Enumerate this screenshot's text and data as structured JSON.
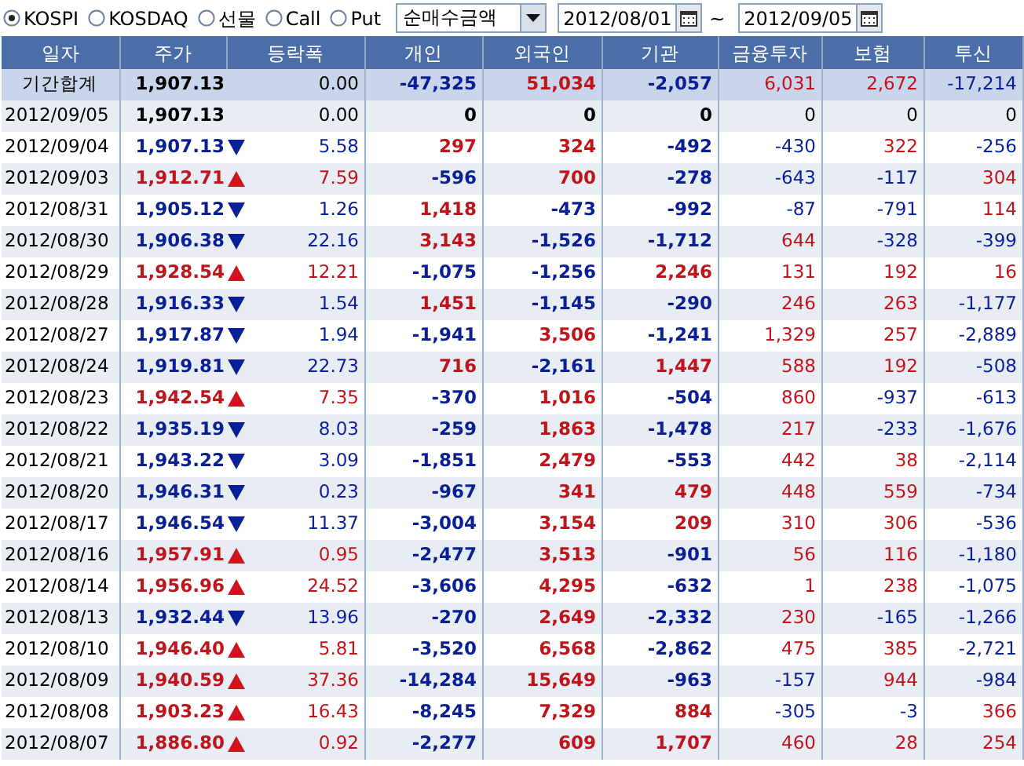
{
  "toolbar": {
    "markets": [
      {
        "label": "KOSPI",
        "selected": true
      },
      {
        "label": "KOSDAQ",
        "selected": false
      },
      {
        "label": "선물",
        "selected": false
      },
      {
        "label": "Call",
        "selected": false
      },
      {
        "label": "Put",
        "selected": false
      }
    ],
    "measure": {
      "value": "순매수금액"
    },
    "start_date": "2012/08/01",
    "separator": "~",
    "end_date": "2012/09/05"
  },
  "table": {
    "columns": [
      "일자",
      "주가",
      "등락폭",
      "개인",
      "외국인",
      "기관",
      "금융투자",
      "보험",
      "투신"
    ],
    "rows": [
      {
        "kind": "total",
        "date": "기간합계",
        "price": {
          "text": "1,907.13",
          "color": "#000000"
        },
        "change": {
          "text": "0.00",
          "color": "#000000"
        },
        "investors": [
          {
            "text": "-47,325",
            "color": "#0a1e96"
          },
          {
            "text": "51,034",
            "color": "#c0141c"
          },
          {
            "text": "-2,057",
            "color": "#0a1e96"
          },
          {
            "text": "6,031",
            "color": "#c0141c"
          },
          {
            "text": "2,672",
            "color": "#c0141c"
          },
          {
            "text": "-17,214",
            "color": "#0a1e96"
          }
        ]
      },
      {
        "kind": "day",
        "date": "2012/09/05",
        "price": {
          "text": "1,907.13",
          "color": "#000000"
        },
        "change": {
          "text": "0.00",
          "color": "#000000"
        },
        "investors": [
          {
            "text": "0",
            "color": "#000000"
          },
          {
            "text": "0",
            "color": "#000000"
          },
          {
            "text": "0",
            "color": "#000000"
          },
          {
            "text": "0",
            "color": "#000000"
          },
          {
            "text": "0",
            "color": "#000000"
          },
          {
            "text": "0",
            "color": "#000000"
          }
        ]
      },
      {
        "kind": "day",
        "date": "2012/09/04",
        "price": {
          "text": "1,907.13",
          "color": "#0a1e96"
        },
        "rising": false,
        "change": {
          "text": "5.58",
          "color": "#0a1e96"
        },
        "investors": [
          {
            "text": "297",
            "color": "#c0141c"
          },
          {
            "text": "324",
            "color": "#c0141c"
          },
          {
            "text": "-492",
            "color": "#0a1e96"
          },
          {
            "text": "-430",
            "color": "#0a1e96"
          },
          {
            "text": "322",
            "color": "#c0141c"
          },
          {
            "text": "-256",
            "color": "#0a1e96"
          }
        ]
      },
      {
        "kind": "day",
        "date": "2012/09/03",
        "price": {
          "text": "1,912.71",
          "color": "#c0141c"
        },
        "rising": true,
        "change": {
          "text": "7.59",
          "color": "#c0141c"
        },
        "investors": [
          {
            "text": "-596",
            "color": "#0a1e96"
          },
          {
            "text": "700",
            "color": "#c0141c"
          },
          {
            "text": "-278",
            "color": "#0a1e96"
          },
          {
            "text": "-643",
            "color": "#0a1e96"
          },
          {
            "text": "-117",
            "color": "#0a1e96"
          },
          {
            "text": "304",
            "color": "#c0141c"
          }
        ]
      },
      {
        "kind": "day",
        "date": "2012/08/31",
        "price": {
          "text": "1,905.12",
          "color": "#0a1e96"
        },
        "rising": false,
        "change": {
          "text": "1.26",
          "color": "#0a1e96"
        },
        "investors": [
          {
            "text": "1,418",
            "color": "#c0141c"
          },
          {
            "text": "-473",
            "color": "#0a1e96"
          },
          {
            "text": "-992",
            "color": "#0a1e96"
          },
          {
            "text": "-87",
            "color": "#0a1e96"
          },
          {
            "text": "-791",
            "color": "#0a1e96"
          },
          {
            "text": "114",
            "color": "#c0141c"
          }
        ]
      },
      {
        "kind": "day",
        "date": "2012/08/30",
        "price": {
          "text": "1,906.38",
          "color": "#0a1e96"
        },
        "rising": false,
        "change": {
          "text": "22.16",
          "color": "#0a1e96"
        },
        "investors": [
          {
            "text": "3,143",
            "color": "#c0141c"
          },
          {
            "text": "-1,526",
            "color": "#0a1e96"
          },
          {
            "text": "-1,712",
            "color": "#0a1e96"
          },
          {
            "text": "644",
            "color": "#c0141c"
          },
          {
            "text": "-328",
            "color": "#0a1e96"
          },
          {
            "text": "-399",
            "color": "#0a1e96"
          }
        ]
      },
      {
        "kind": "day",
        "date": "2012/08/29",
        "price": {
          "text": "1,928.54",
          "color": "#c0141c"
        },
        "rising": true,
        "change": {
          "text": "12.21",
          "color": "#c0141c"
        },
        "investors": [
          {
            "text": "-1,075",
            "color": "#0a1e96"
          },
          {
            "text": "-1,256",
            "color": "#0a1e96"
          },
          {
            "text": "2,246",
            "color": "#c0141c"
          },
          {
            "text": "131",
            "color": "#c0141c"
          },
          {
            "text": "192",
            "color": "#c0141c"
          },
          {
            "text": "16",
            "color": "#c0141c"
          }
        ]
      },
      {
        "kind": "day",
        "date": "2012/08/28",
        "price": {
          "text": "1,916.33",
          "color": "#0a1e96"
        },
        "rising": false,
        "change": {
          "text": "1.54",
          "color": "#0a1e96"
        },
        "investors": [
          {
            "text": "1,451",
            "color": "#c0141c"
          },
          {
            "text": "-1,145",
            "color": "#0a1e96"
          },
          {
            "text": "-290",
            "color": "#0a1e96"
          },
          {
            "text": "246",
            "color": "#c0141c"
          },
          {
            "text": "263",
            "color": "#c0141c"
          },
          {
            "text": "-1,177",
            "color": "#0a1e96"
          }
        ]
      },
      {
        "kind": "day",
        "date": "2012/08/27",
        "price": {
          "text": "1,917.87",
          "color": "#0a1e96"
        },
        "rising": false,
        "change": {
          "text": "1.94",
          "color": "#0a1e96"
        },
        "investors": [
          {
            "text": "-1,941",
            "color": "#0a1e96"
          },
          {
            "text": "3,506",
            "color": "#c0141c"
          },
          {
            "text": "-1,241",
            "color": "#0a1e96"
          },
          {
            "text": "1,329",
            "color": "#c0141c"
          },
          {
            "text": "257",
            "color": "#c0141c"
          },
          {
            "text": "-2,889",
            "color": "#0a1e96"
          }
        ]
      },
      {
        "kind": "day",
        "date": "2012/08/24",
        "price": {
          "text": "1,919.81",
          "color": "#0a1e96"
        },
        "rising": false,
        "change": {
          "text": "22.73",
          "color": "#0a1e96"
        },
        "investors": [
          {
            "text": "716",
            "color": "#c0141c"
          },
          {
            "text": "-2,161",
            "color": "#0a1e96"
          },
          {
            "text": "1,447",
            "color": "#c0141c"
          },
          {
            "text": "588",
            "color": "#c0141c"
          },
          {
            "text": "192",
            "color": "#c0141c"
          },
          {
            "text": "-508",
            "color": "#0a1e96"
          }
        ]
      },
      {
        "kind": "day",
        "date": "2012/08/23",
        "price": {
          "text": "1,942.54",
          "color": "#c0141c"
        },
        "rising": true,
        "change": {
          "text": "7.35",
          "color": "#c0141c"
        },
        "investors": [
          {
            "text": "-370",
            "color": "#0a1e96"
          },
          {
            "text": "1,016",
            "color": "#c0141c"
          },
          {
            "text": "-504",
            "color": "#0a1e96"
          },
          {
            "text": "860",
            "color": "#c0141c"
          },
          {
            "text": "-937",
            "color": "#0a1e96"
          },
          {
            "text": "-613",
            "color": "#0a1e96"
          }
        ]
      },
      {
        "kind": "day",
        "date": "2012/08/22",
        "price": {
          "text": "1,935.19",
          "color": "#0a1e96"
        },
        "rising": false,
        "change": {
          "text": "8.03",
          "color": "#0a1e96"
        },
        "investors": [
          {
            "text": "-259",
            "color": "#0a1e96"
          },
          {
            "text": "1,863",
            "color": "#c0141c"
          },
          {
            "text": "-1,478",
            "color": "#0a1e96"
          },
          {
            "text": "217",
            "color": "#c0141c"
          },
          {
            "text": "-233",
            "color": "#0a1e96"
          },
          {
            "text": "-1,676",
            "color": "#0a1e96"
          }
        ]
      },
      {
        "kind": "day",
        "date": "2012/08/21",
        "price": {
          "text": "1,943.22",
          "color": "#0a1e96"
        },
        "rising": false,
        "change": {
          "text": "3.09",
          "color": "#0a1e96"
        },
        "investors": [
          {
            "text": "-1,851",
            "color": "#0a1e96"
          },
          {
            "text": "2,479",
            "color": "#c0141c"
          },
          {
            "text": "-553",
            "color": "#0a1e96"
          },
          {
            "text": "442",
            "color": "#c0141c"
          },
          {
            "text": "38",
            "color": "#c0141c"
          },
          {
            "text": "-2,114",
            "color": "#0a1e96"
          }
        ]
      },
      {
        "kind": "day",
        "date": "2012/08/20",
        "price": {
          "text": "1,946.31",
          "color": "#0a1e96"
        },
        "rising": false,
        "change": {
          "text": "0.23",
          "color": "#0a1e96"
        },
        "investors": [
          {
            "text": "-967",
            "color": "#0a1e96"
          },
          {
            "text": "341",
            "color": "#c0141c"
          },
          {
            "text": "479",
            "color": "#c0141c"
          },
          {
            "text": "448",
            "color": "#c0141c"
          },
          {
            "text": "559",
            "color": "#c0141c"
          },
          {
            "text": "-734",
            "color": "#0a1e96"
          }
        ]
      },
      {
        "kind": "day",
        "date": "2012/08/17",
        "price": {
          "text": "1,946.54",
          "color": "#0a1e96"
        },
        "rising": false,
        "change": {
          "text": "11.37",
          "color": "#0a1e96"
        },
        "investors": [
          {
            "text": "-3,004",
            "color": "#0a1e96"
          },
          {
            "text": "3,154",
            "color": "#c0141c"
          },
          {
            "text": "209",
            "color": "#c0141c"
          },
          {
            "text": "310",
            "color": "#c0141c"
          },
          {
            "text": "306",
            "color": "#c0141c"
          },
          {
            "text": "-536",
            "color": "#0a1e96"
          }
        ]
      },
      {
        "kind": "day",
        "date": "2012/08/16",
        "price": {
          "text": "1,957.91",
          "color": "#c0141c"
        },
        "rising": true,
        "change": {
          "text": "0.95",
          "color": "#c0141c"
        },
        "investors": [
          {
            "text": "-2,477",
            "color": "#0a1e96"
          },
          {
            "text": "3,513",
            "color": "#c0141c"
          },
          {
            "text": "-901",
            "color": "#0a1e96"
          },
          {
            "text": "56",
            "color": "#c0141c"
          },
          {
            "text": "116",
            "color": "#c0141c"
          },
          {
            "text": "-1,180",
            "color": "#0a1e96"
          }
        ]
      },
      {
        "kind": "day",
        "date": "2012/08/14",
        "price": {
          "text": "1,956.96",
          "color": "#c0141c"
        },
        "rising": true,
        "change": {
          "text": "24.52",
          "color": "#c0141c"
        },
        "investors": [
          {
            "text": "-3,606",
            "color": "#0a1e96"
          },
          {
            "text": "4,295",
            "color": "#c0141c"
          },
          {
            "text": "-632",
            "color": "#0a1e96"
          },
          {
            "text": "1",
            "color": "#c0141c"
          },
          {
            "text": "238",
            "color": "#c0141c"
          },
          {
            "text": "-1,075",
            "color": "#0a1e96"
          }
        ]
      },
      {
        "kind": "day",
        "date": "2012/08/13",
        "price": {
          "text": "1,932.44",
          "color": "#0a1e96"
        },
        "rising": false,
        "change": {
          "text": "13.96",
          "color": "#0a1e96"
        },
        "investors": [
          {
            "text": "-270",
            "color": "#0a1e96"
          },
          {
            "text": "2,649",
            "color": "#c0141c"
          },
          {
            "text": "-2,332",
            "color": "#0a1e96"
          },
          {
            "text": "230",
            "color": "#c0141c"
          },
          {
            "text": "-165",
            "color": "#0a1e96"
          },
          {
            "text": "-1,266",
            "color": "#0a1e96"
          }
        ]
      },
      {
        "kind": "day",
        "date": "2012/08/10",
        "price": {
          "text": "1,946.40",
          "color": "#c0141c"
        },
        "rising": true,
        "change": {
          "text": "5.81",
          "color": "#c0141c"
        },
        "investors": [
          {
            "text": "-3,520",
            "color": "#0a1e96"
          },
          {
            "text": "6,568",
            "color": "#c0141c"
          },
          {
            "text": "-2,862",
            "color": "#0a1e96"
          },
          {
            "text": "475",
            "color": "#c0141c"
          },
          {
            "text": "385",
            "color": "#c0141c"
          },
          {
            "text": "-2,721",
            "color": "#0a1e96"
          }
        ]
      },
      {
        "kind": "day",
        "date": "2012/08/09",
        "price": {
          "text": "1,940.59",
          "color": "#c0141c"
        },
        "rising": true,
        "change": {
          "text": "37.36",
          "color": "#c0141c"
        },
        "investors": [
          {
            "text": "-14,284",
            "color": "#0a1e96"
          },
          {
            "text": "15,649",
            "color": "#c0141c"
          },
          {
            "text": "-963",
            "color": "#0a1e96"
          },
          {
            "text": "-157",
            "color": "#0a1e96"
          },
          {
            "text": "944",
            "color": "#c0141c"
          },
          {
            "text": "-984",
            "color": "#0a1e96"
          }
        ]
      },
      {
        "kind": "day",
        "date": "2012/08/08",
        "price": {
          "text": "1,903.23",
          "color": "#c0141c"
        },
        "rising": true,
        "change": {
          "text": "16.43",
          "color": "#c0141c"
        },
        "investors": [
          {
            "text": "-8,245",
            "color": "#0a1e96"
          },
          {
            "text": "7,329",
            "color": "#c0141c"
          },
          {
            "text": "884",
            "color": "#c0141c"
          },
          {
            "text": "-305",
            "color": "#0a1e96"
          },
          {
            "text": "-3",
            "color": "#0a1e96"
          },
          {
            "text": "366",
            "color": "#c0141c"
          }
        ]
      },
      {
        "kind": "day",
        "date": "2012/08/07",
        "price": {
          "text": "1,886.80",
          "color": "#c0141c"
        },
        "rising": true,
        "change": {
          "text": "0.92",
          "color": "#c0141c"
        },
        "investors": [
          {
            "text": "-2,277",
            "color": "#0a1e96"
          },
          {
            "text": "609",
            "color": "#c0141c"
          },
          {
            "text": "1,707",
            "color": "#c0141c"
          },
          {
            "text": "460",
            "color": "#c0141c"
          },
          {
            "text": "28",
            "color": "#c0141c"
          },
          {
            "text": "254",
            "color": "#c0141c"
          }
        ]
      }
    ]
  }
}
